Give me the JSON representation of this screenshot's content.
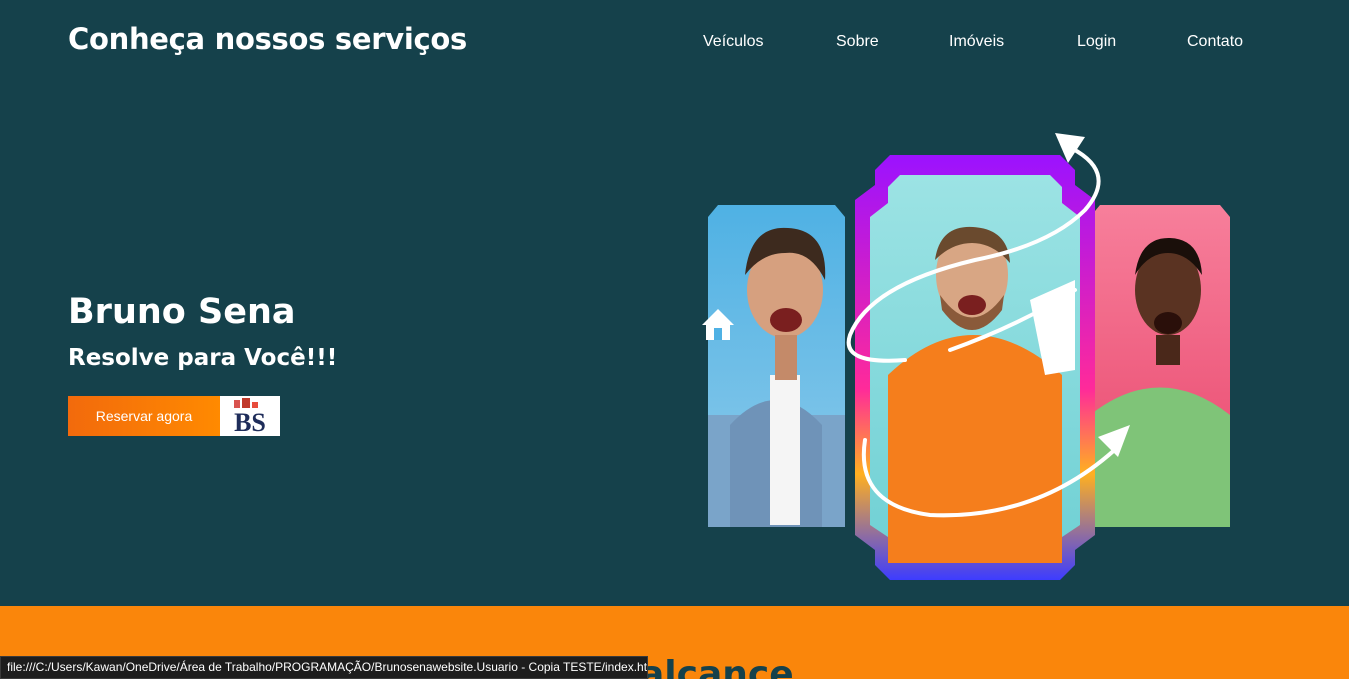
{
  "header": {
    "title": "Conheça nossos serviços",
    "nav": [
      "Veículos",
      "Sobre",
      "Imóveis",
      "Login",
      "Contato"
    ]
  },
  "hero": {
    "name": "Bruno Sena",
    "subtitle": "Resolve para Você!!!",
    "cta_label": "Reservar agora",
    "logo_text": "BS"
  },
  "section": {
    "heading_partial": "alcance"
  },
  "status_bar": {
    "url": "file:///C:/Users/Kawan/OneDrive/Área de Trabalho/PROGRAMAÇÃO/Brunosenawebsite.Usuario - Copia TESTE/index.html"
  },
  "colors": {
    "background": "#15414b",
    "accent_orange": "#fa860b",
    "text": "#ffffff"
  },
  "icons": [
    "house-icon",
    "arrow-icon"
  ]
}
